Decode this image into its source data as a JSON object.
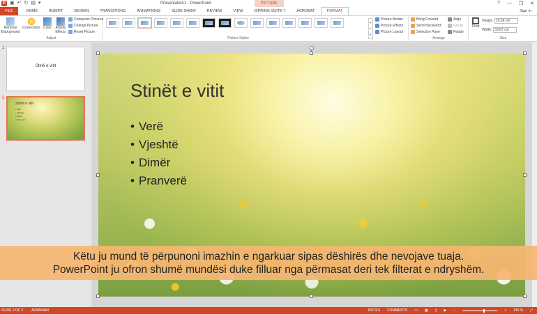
{
  "titlebar": {
    "title": "Presentation1 - PowerPoint",
    "contextual_tab": "PICTURE TOOLS",
    "help": "?",
    "minimize": "—",
    "restore": "❐",
    "close": "✕"
  },
  "tabs": [
    {
      "label": "FILE"
    },
    {
      "label": "HOME"
    },
    {
      "label": "INSERT"
    },
    {
      "label": "DESIGN"
    },
    {
      "label": "TRANSITIONS"
    },
    {
      "label": "ANIMATIONS"
    },
    {
      "label": "SLIDE SHOW"
    },
    {
      "label": "REVIEW"
    },
    {
      "label": "VIEW"
    },
    {
      "label": "ISPRING SUITE 7"
    },
    {
      "label": "ACROBAT"
    },
    {
      "label": "FORMAT"
    }
  ],
  "signin": "Sign in",
  "ribbon": {
    "adjust": {
      "remove_background": "Remove Background",
      "corrections": "Corrections",
      "color": "Color",
      "artistic_effects": "Artistic Effects",
      "compress": "Compress Pictures",
      "change": "Change Picture",
      "reset": "Reset Picture",
      "label": "Adjust"
    },
    "styles": {
      "label": "Picture Styles"
    },
    "format_opts": {
      "border": "Picture Border",
      "effects": "Picture Effects",
      "layout": "Picture Layout"
    },
    "arrange": {
      "bring_forward": "Bring Forward",
      "send_backward": "Send Backward",
      "selection_pane": "Selection Pane",
      "align": "Align",
      "group": "Group",
      "rotate": "Rotate",
      "label": "Arrange"
    },
    "size": {
      "crop": "Crop",
      "height_label": "Height:",
      "height_value": "19,24 cm",
      "width_label": "Width:",
      "width_value": "33,87 cm",
      "label": "Size"
    }
  },
  "thumbnails": {
    "slide1": {
      "num": "1",
      "title": "Stinë e vitit",
      "subtitle": "................"
    },
    "slide2": {
      "num": "2",
      "title": "Stinët e vitit",
      "bullets": [
        "• Verë",
        "• Vjeshtë",
        "• Dimër",
        "• Pranverë"
      ]
    }
  },
  "slide": {
    "title": "Stinët e vitit",
    "bullets": [
      "Verë",
      "Vjeshtë",
      "Dimër",
      "Pranverë"
    ]
  },
  "caption": {
    "line1": "Këtu ju mund të përpunoni imazhin e ngarkuar sipas dëshirës dhe nevojave tuaja.",
    "line2": "PowerPoint ju ofron shumë mundësi duke filluar nga përmasat deri tek filterat e ndryshëm."
  },
  "status": {
    "slide": "SLIDE 2 OF 2",
    "language": "ALBANIAN",
    "notes": "NOTES",
    "comments": "COMMENTS",
    "zoom": "115 %"
  },
  "colors": {
    "accent": "#D24726",
    "caption_bg": "#F5B671"
  }
}
